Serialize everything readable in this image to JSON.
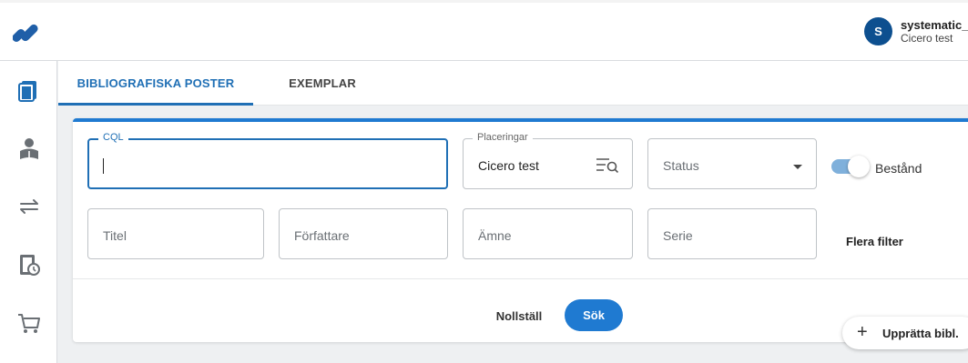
{
  "header": {
    "logo": "app-logo",
    "user": {
      "avatar_letter": "S",
      "name": "systematic_",
      "org": "Cicero test"
    }
  },
  "sidebar": {
    "items": [
      {
        "icon": "catalog-books-icon"
      },
      {
        "icon": "patron-reading-icon"
      },
      {
        "icon": "transfer-arrows-icon"
      },
      {
        "icon": "history-clock-icon"
      },
      {
        "icon": "cart-icon"
      }
    ]
  },
  "tabs": [
    {
      "label": "BIBLIOGRAFISKA POSTER",
      "active": true
    },
    {
      "label": "EXEMPLAR",
      "active": false
    }
  ],
  "search": {
    "cql": {
      "label": "CQL",
      "value": ""
    },
    "placeringar": {
      "label": "Placeringar",
      "value": "Cicero test"
    },
    "status": {
      "placeholder": "Status"
    },
    "bestand": {
      "label": "Bestånd",
      "enabled": true
    },
    "titel": {
      "placeholder": "Titel"
    },
    "forfattare": {
      "placeholder": "Författare"
    },
    "amne": {
      "placeholder": "Ämne"
    },
    "serie": {
      "placeholder": "Serie"
    },
    "more_filters": "Flera filter",
    "reset_label": "Nollställ",
    "search_label": "Sök"
  },
  "fab": {
    "plus": "+",
    "label": "Upprätta bibl."
  },
  "colors": {
    "accent": "#1f7ad1",
    "active_tab": "#1f6fb5",
    "avatar": "#0d4f8f",
    "toggle_track": "#7fb0db"
  }
}
